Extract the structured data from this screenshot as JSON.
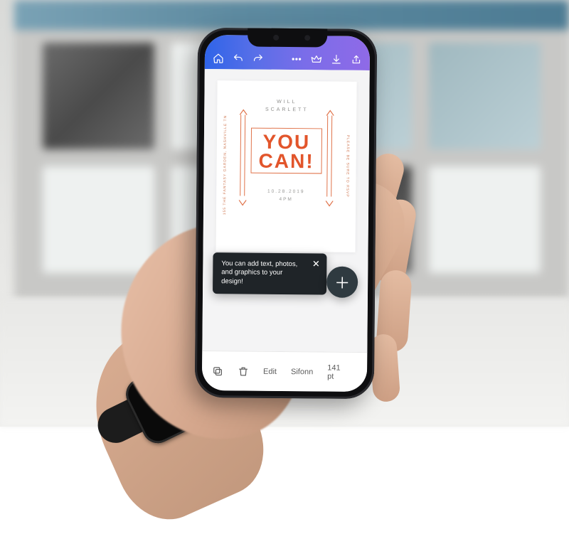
{
  "topbar": {
    "icons": [
      "home",
      "undo",
      "redo",
      "more",
      "crown",
      "download",
      "share"
    ]
  },
  "card": {
    "author_line1": "WILL",
    "author_line2": "SCARLETT",
    "headline_line1": "YOU",
    "headline_line2": "CAN!",
    "left_vertical": "155 THE FANTASY GARDEN, NASHVILLE TN",
    "right_vertical": "PLEASE BE SURE TO RSVP",
    "sub_line1": "10.28.2019",
    "sub_line2": "4PM"
  },
  "tooltip": {
    "text": "You can add text, photos, and graphics to your design!"
  },
  "bottombar": {
    "edit_label": "Edit",
    "font_name": "Sifonn",
    "font_size": "141 pt"
  },
  "colors": {
    "accent": "#e2552b",
    "toolbar_gradient_start": "#2f64e8",
    "toolbar_gradient_end": "#8f6ae7",
    "tooltip_bg": "#1f2428",
    "fab_bg": "#2f3a40"
  }
}
